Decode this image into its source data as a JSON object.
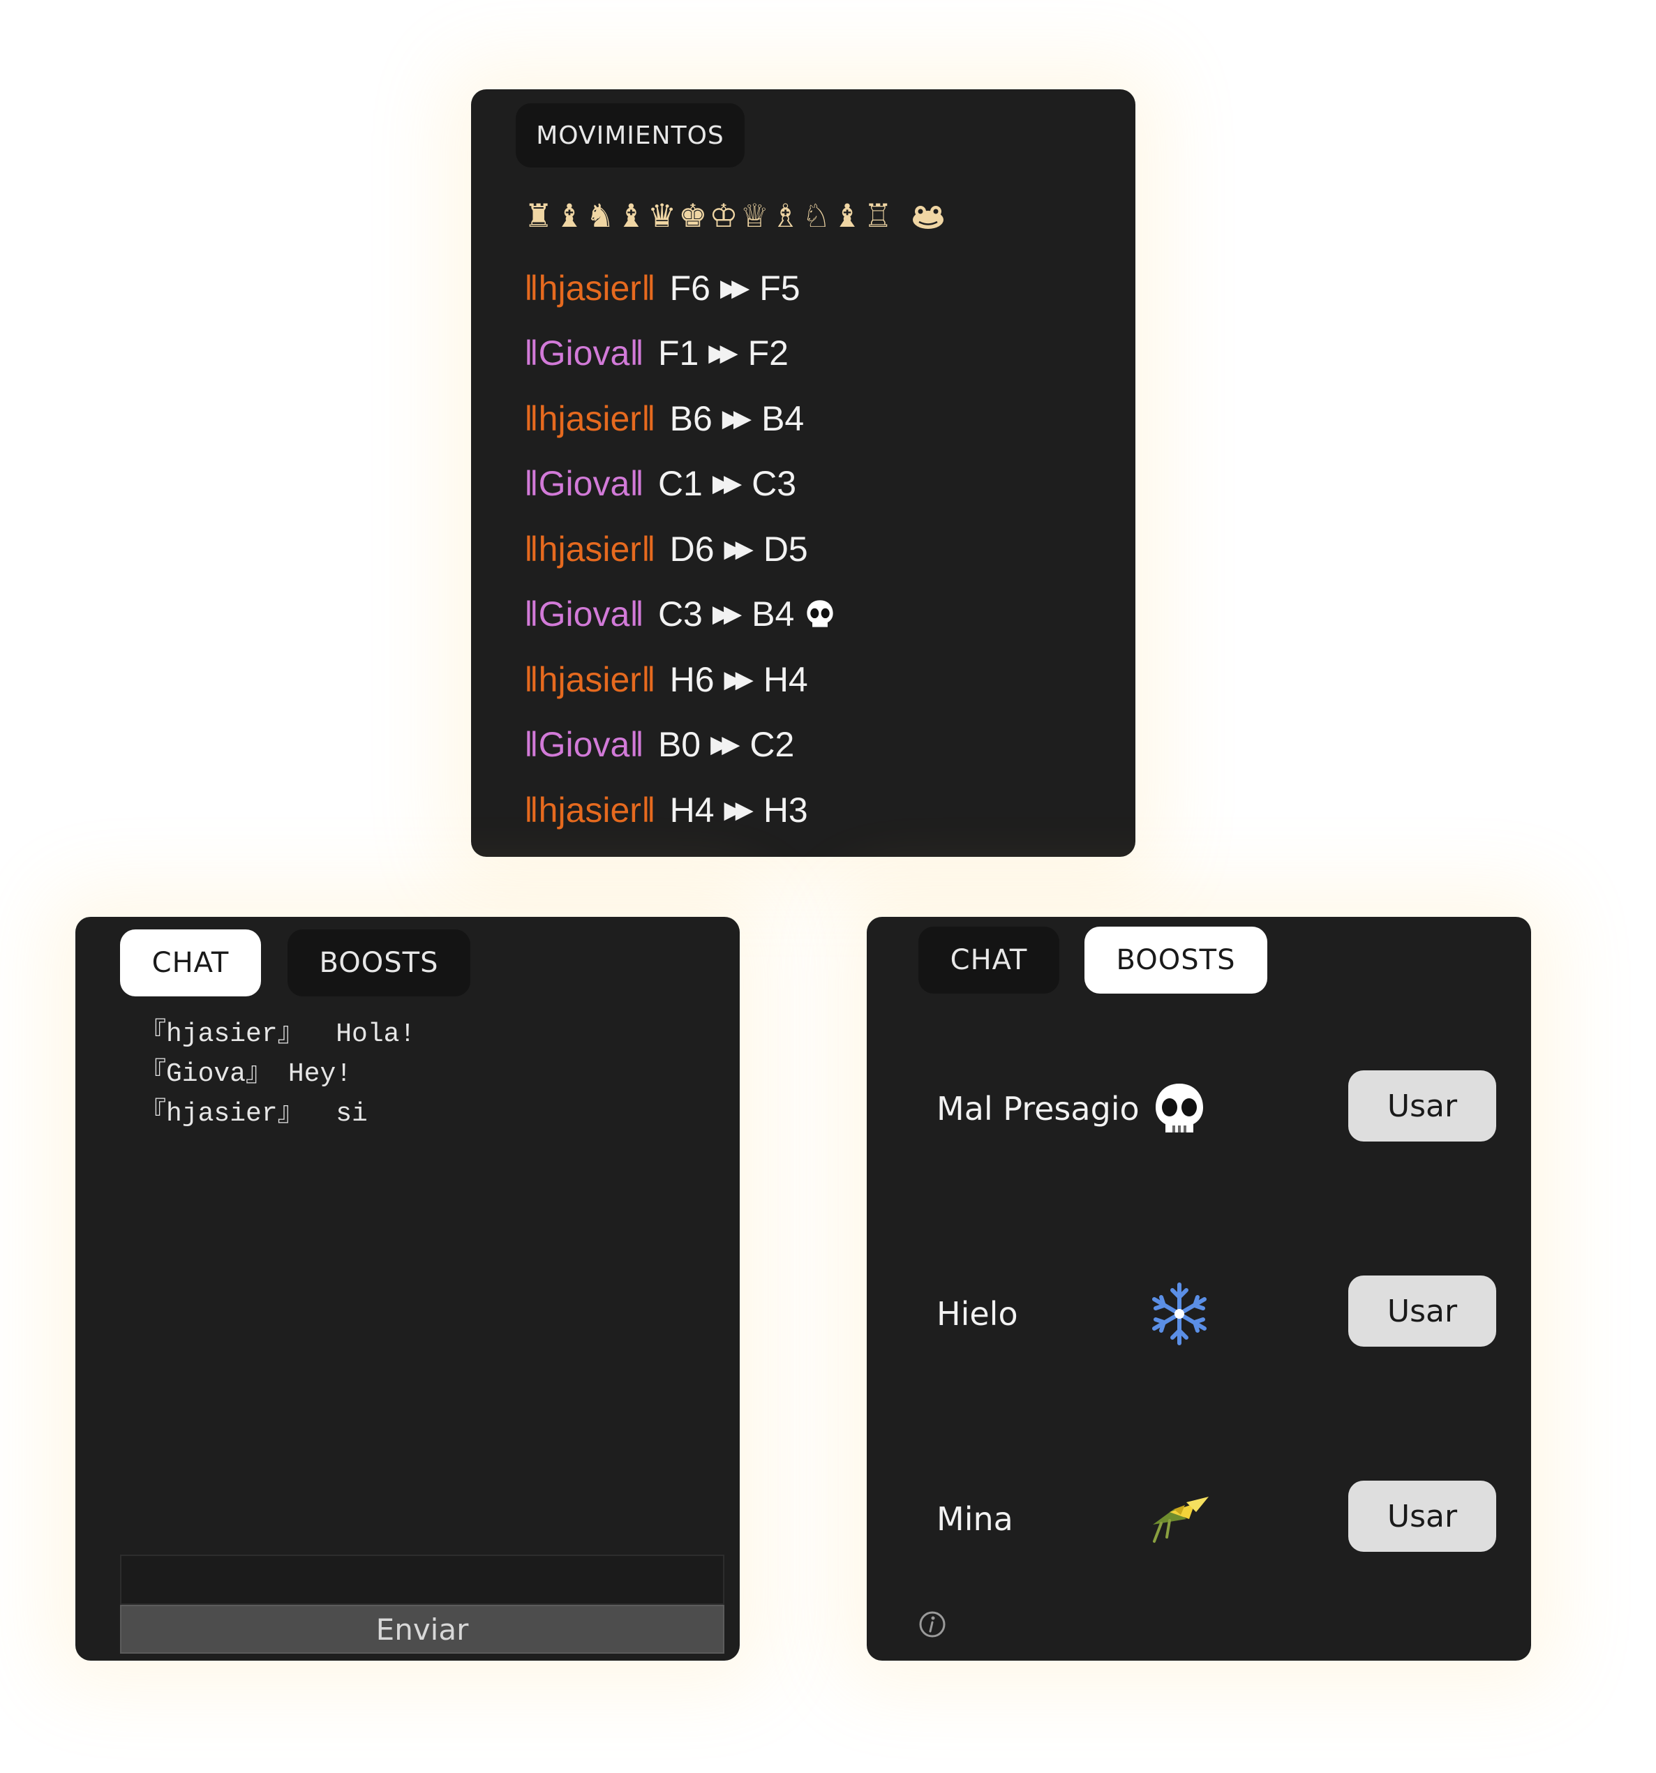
{
  "moves_panel": {
    "tab_label": "MOVIMIENTOS",
    "captured_pieces": "♜♝♞♝♛♚♔♕♗♘♝♖",
    "captured_extra_icon": "frog-icon",
    "moves": [
      {
        "player": "hjasier",
        "from": "F6",
        "to": "F5",
        "captured": ""
      },
      {
        "player": "Giova",
        "from": "F1",
        "to": "F2",
        "captured": ""
      },
      {
        "player": "hjasier",
        "from": "B6",
        "to": "B4",
        "captured": ""
      },
      {
        "player": "Giova",
        "from": "C1",
        "to": "C3",
        "captured": ""
      },
      {
        "player": "hjasier",
        "from": "D6",
        "to": "D5",
        "captured": ""
      },
      {
        "player": "Giova",
        "from": "C3",
        "to": "B4",
        "captured": "skull-icon"
      },
      {
        "player": "hjasier",
        "from": "H6",
        "to": "H4",
        "captured": ""
      },
      {
        "player": "Giova",
        "from": "B0",
        "to": "C2",
        "captured": ""
      },
      {
        "player": "hjasier",
        "from": "H4",
        "to": "H3",
        "captured": ""
      }
    ],
    "arrow_glyph": "⏩",
    "player_colors": {
      "hjasier": "#e66a1f",
      "Giova": "#d27ad8"
    }
  },
  "chat_panel": {
    "tabs": [
      "CHAT",
      "BOOSTS"
    ],
    "active_tab": "CHAT",
    "messages": [
      {
        "user": "hjasier",
        "text": "Hola!"
      },
      {
        "user": "Giova",
        "text": "Hey!"
      },
      {
        "user": "hjasier",
        "text": "si"
      }
    ],
    "input_value": "",
    "send_label": "Enviar"
  },
  "boosts_panel": {
    "tabs": [
      "CHAT",
      "BOOSTS"
    ],
    "active_tab": "BOOSTS",
    "boosts": [
      {
        "name": "Mal Presagio",
        "icon": "skull-icon",
        "button": "Usar"
      },
      {
        "name": "Hielo",
        "icon": "snowflake-icon",
        "button": "Usar"
      },
      {
        "name": "Mina",
        "icon": "mine-icon",
        "button": "Usar"
      }
    ],
    "info_icon": "info-icon"
  },
  "colors": {
    "panel_bg": "#1e1e1e",
    "tab_dark": "#141414",
    "tab_light": "#ffffff",
    "button_bg": "#dedede",
    "glow": "#ffd678"
  }
}
